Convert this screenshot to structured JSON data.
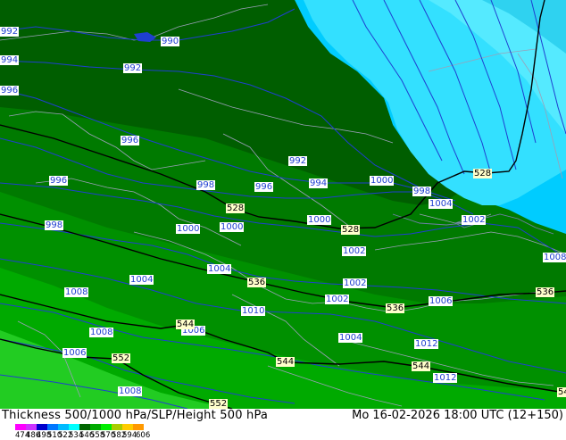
{
  "footer": {
    "title": "Thickness 500/1000 hPa/SLP/Height 500 hPa",
    "datetime": "Mo 16-02-2026 18:00 UTC (12+150)"
  },
  "legend": {
    "labels": [
      "474",
      "486",
      "498",
      "510",
      "522",
      "534",
      "546",
      "558",
      "570",
      "582",
      "594",
      "606"
    ],
    "colors": [
      "#ff00ff",
      "#cc33ff",
      "#0000cc",
      "#0077ff",
      "#00bbff",
      "#00ffff",
      "#006600",
      "#00aa00",
      "#00ee00",
      "#aacc00",
      "#ffcc00",
      "#ff9900"
    ]
  },
  "map": {
    "isobar_labels": [
      "992",
      "990",
      "994",
      "992",
      "996",
      "996",
      "992",
      "994",
      "996",
      "998",
      "1000",
      "998",
      "996",
      "1000",
      "998",
      "1004",
      "1002",
      "1000",
      "1000",
      "1002",
      "1004",
      "1002",
      "1008",
      "1008",
      "1004",
      "1002",
      "1006",
      "1010",
      "1008",
      "1006",
      "1004",
      "1012",
      "1006",
      "1012",
      "1008"
    ],
    "thickness_labels": [
      "528",
      "528",
      "528",
      "536",
      "536",
      "536",
      "544",
      "544",
      "544",
      "552",
      "552",
      "54"
    ],
    "colors": {
      "isobar": "#1f3fd0",
      "thickness": "#000000",
      "border": "#9aa0b8"
    }
  }
}
